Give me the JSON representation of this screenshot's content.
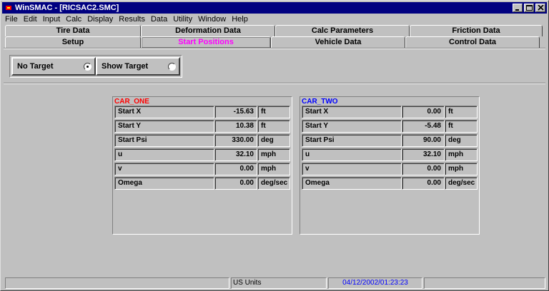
{
  "window": {
    "title": "WinSMAC - [RICSAC2.SMC]"
  },
  "menubar": {
    "items": [
      "File",
      "Edit",
      "Input",
      "Calc",
      "Display",
      "Results",
      "Data",
      "Utility",
      "Window",
      "Help"
    ]
  },
  "tabs": {
    "back_row": [
      "Tire Data",
      "Deformation Data",
      "Calc Parameters",
      "Friction Data"
    ],
    "front_row": [
      "Setup",
      "Start Positions",
      "Vehicle Data",
      "Control Data"
    ],
    "active": "Start Positions"
  },
  "target_mode": {
    "options": [
      {
        "label": "No Target",
        "selected": true
      },
      {
        "label": "Show Target",
        "selected": false
      }
    ]
  },
  "car_one": {
    "title": "CAR_ONE",
    "color": "#ff0000",
    "rows": [
      {
        "label": "Start X",
        "value": "-15.63",
        "unit": "ft"
      },
      {
        "label": "Start Y",
        "value": "10.38",
        "unit": "ft"
      },
      {
        "label": "Start Psi",
        "value": "330.00",
        "unit": "deg"
      },
      {
        "label": "u",
        "value": "32.10",
        "unit": "mph"
      },
      {
        "label": "v",
        "value": "0.00",
        "unit": "mph"
      },
      {
        "label": "Omega",
        "value": "0.00",
        "unit": "deg/sec"
      }
    ]
  },
  "car_two": {
    "title": "CAR_TWO",
    "color": "#0000ff",
    "rows": [
      {
        "label": "Start X",
        "value": "0.00",
        "unit": "ft"
      },
      {
        "label": "Start Y",
        "value": "-5.48",
        "unit": "ft"
      },
      {
        "label": "Start Psi",
        "value": "90.00",
        "unit": "deg"
      },
      {
        "label": "u",
        "value": "32.10",
        "unit": "mph"
      },
      {
        "label": "v",
        "value": "0.00",
        "unit": "mph"
      },
      {
        "label": "Omega",
        "value": "0.00",
        "unit": "deg/sec"
      }
    ]
  },
  "statusbar": {
    "units": "US Units",
    "datetime": "04/12/2002/01:23:23",
    "datetime_color": "#0000ff"
  },
  "colors": {
    "titlebar": "#000080",
    "active_tab_text": "#ff00ff",
    "face": "#c0c0c0"
  }
}
